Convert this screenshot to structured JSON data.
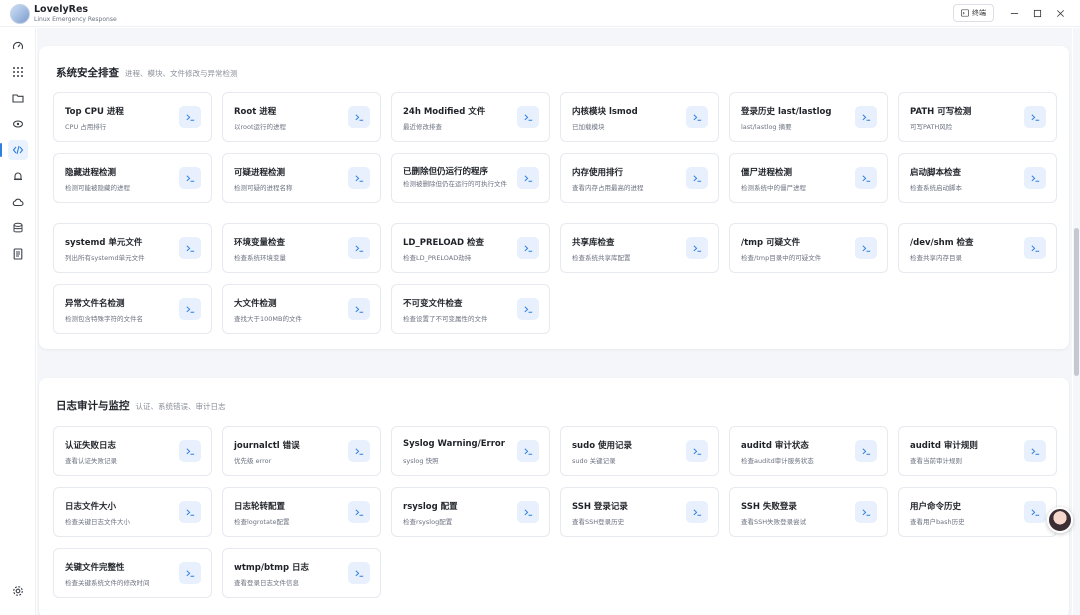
{
  "app": {
    "name": "LovelyRes",
    "subtitle": "Linux Emergency Response",
    "terminal_label": "终端"
  },
  "rail": [
    "dashboard-icon",
    "grid-icon",
    "folder-icon",
    "network-icon",
    "code-icon",
    "alert-icon",
    "cloud-icon",
    "database-icon",
    "document-icon",
    "settings-icon"
  ],
  "sections": [
    {
      "title": "系统安全排查",
      "subtitle": "进程、模块、文件修改与异常检测",
      "cards": [
        {
          "title": "Top CPU 进程",
          "desc": "CPU 占用排行"
        },
        {
          "title": "Root 进程",
          "desc": "以root运行的进程"
        },
        {
          "title": "24h Modified 文件",
          "desc": "最近修改排查"
        },
        {
          "title": "内核模块 lsmod",
          "desc": "已加载模块"
        },
        {
          "title": "登录历史 last/lastlog",
          "desc": "last/lastlog 摘要"
        },
        {
          "title": "PATH 可写检测",
          "desc": "可写PATH风险"
        },
        {
          "title": "隐藏进程检测",
          "desc": "检测可能被隐藏的进程"
        },
        {
          "title": "可疑进程检测",
          "desc": "检测可疑的进程名称"
        },
        {
          "title": "已删除但仍运行的程序",
          "desc": "检测被删除但仍在运行的可执行文件"
        },
        {
          "title": "内存使用排行",
          "desc": "查看内存占用最高的进程"
        },
        {
          "title": "僵尸进程检测",
          "desc": "检测系统中的僵尸进程"
        },
        {
          "title": "启动脚本检查",
          "desc": "检查系统启动脚本"
        },
        {
          "title": "systemd 单元文件",
          "desc": "列出所有systemd单元文件"
        },
        {
          "title": "环境变量检查",
          "desc": "检查系统环境变量"
        },
        {
          "title": "LD_PRELOAD 检查",
          "desc": "检查LD_PRELOAD劫持"
        },
        {
          "title": "共享库检查",
          "desc": "检查系统共享库配置"
        },
        {
          "title": "/tmp 可疑文件",
          "desc": "检查/tmp目录中的可疑文件"
        },
        {
          "title": "/dev/shm 检查",
          "desc": "检查共享内存目录"
        },
        {
          "title": "异常文件名检测",
          "desc": "检测包含特殊字符的文件名"
        },
        {
          "title": "大文件检测",
          "desc": "查找大于100MB的文件"
        },
        {
          "title": "不可变文件检查",
          "desc": "检查设置了不可变属性的文件"
        }
      ]
    },
    {
      "title": "日志审计与监控",
      "subtitle": "认证、系统错误、审计日志",
      "cards": [
        {
          "title": "认证失败日志",
          "desc": "查看认证失败记录"
        },
        {
          "title": "journalctl 错误",
          "desc": "优先级 error"
        },
        {
          "title": "Syslog Warning/Error",
          "desc": "syslog 快照"
        },
        {
          "title": "sudo 使用记录",
          "desc": "sudo 关键记录"
        },
        {
          "title": "auditd 审计状态",
          "desc": "检查auditd审计服务状态"
        },
        {
          "title": "auditd 审计规则",
          "desc": "查看当前审计规则"
        },
        {
          "title": "日志文件大小",
          "desc": "检查关键日志文件大小"
        },
        {
          "title": "日志轮转配置",
          "desc": "检查logrotate配置"
        },
        {
          "title": "rsyslog 配置",
          "desc": "检查rsyslog配置"
        },
        {
          "title": "SSH 登录记录",
          "desc": "查看SSH登录历史"
        },
        {
          "title": "SSH 失败登录",
          "desc": "查看SSH失败登录尝试"
        },
        {
          "title": "用户命令历史",
          "desc": "查看用户bash历史"
        },
        {
          "title": "关键文件完整性",
          "desc": "检查关键系统文件的修改时间"
        },
        {
          "title": "wtmp/btmp 日志",
          "desc": "查看登录日志文件信息"
        }
      ]
    }
  ]
}
